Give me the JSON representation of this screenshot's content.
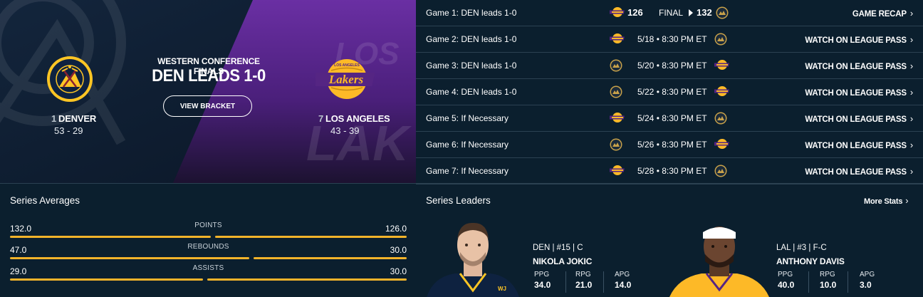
{
  "colors": {
    "background": "#0b1f2e",
    "accent_gold": "#f2b32a",
    "nuggets_navy": "#0e2240",
    "lakers_purple": "#552583",
    "divider": "#2b4152"
  },
  "hero": {
    "conference": "WESTERN CONFERENCE FINALS",
    "status": "DEN LEADS 1-0",
    "bracket_button": "VIEW BRACKET",
    "home_team": {
      "seed": "1",
      "name": "DENVER",
      "record": "53 - 29",
      "logo": "nuggets-logo"
    },
    "away_team": {
      "seed": "7",
      "name": "LOS ANGELES",
      "record": "43 - 39",
      "logo": "lakers-logo"
    }
  },
  "schedule": {
    "games": [
      {
        "label": "Game 1: DEN leads 1-0",
        "left_logo": "lakers-logo",
        "left_score": "126",
        "status": "FINAL",
        "right_score": "132",
        "right_logo": "nuggets-logo",
        "link": "GAME RECAP"
      },
      {
        "label": "Game 2: DEN leads 1-0",
        "left_logo": "lakers-logo",
        "date": "5/18 • 8:30 PM ET",
        "right_logo": "nuggets-logo",
        "link": "WATCH ON LEAGUE PASS"
      },
      {
        "label": "Game 3: DEN leads 1-0",
        "left_logo": "nuggets-logo",
        "date": "5/20 • 8:30 PM ET",
        "right_logo": "lakers-logo",
        "link": "WATCH ON LEAGUE PASS"
      },
      {
        "label": "Game 4: DEN leads 1-0",
        "left_logo": "nuggets-logo",
        "date": "5/22 • 8:30 PM ET",
        "right_logo": "lakers-logo",
        "link": "WATCH ON LEAGUE PASS"
      },
      {
        "label": "Game 5: If Necessary",
        "left_logo": "lakers-logo",
        "date": "5/24 • 8:30 PM ET",
        "right_logo": "nuggets-logo",
        "link": "WATCH ON LEAGUE PASS"
      },
      {
        "label": "Game 6: If Necessary",
        "left_logo": "nuggets-logo",
        "date": "5/26 • 8:30 PM ET",
        "right_logo": "lakers-logo",
        "link": "WATCH ON LEAGUE PASS"
      },
      {
        "label": "Game 7: If Necessary",
        "left_logo": "lakers-logo",
        "date": "5/28 • 8:30 PM ET",
        "right_logo": "nuggets-logo",
        "link": "WATCH ON LEAGUE PASS"
      }
    ],
    "chevron": "›"
  },
  "averages": {
    "title": "Series Averages",
    "rows": [
      {
        "stat": "POINTS",
        "left": "132.0",
        "right": "126.0",
        "left_value": 132.0,
        "right_value": 126.0
      },
      {
        "stat": "REBOUNDS",
        "left": "47.0",
        "right": "30.0",
        "left_value": 47.0,
        "right_value": 30.0
      },
      {
        "stat": "ASSISTS",
        "left": "29.0",
        "right": "30.0",
        "left_value": 29.0,
        "right_value": 30.0
      }
    ]
  },
  "leaders": {
    "title": "Series Leaders",
    "more_stats": "More Stats",
    "players": [
      {
        "meta": "DEN | #15 | C",
        "name": "NIKOLA JOKIC",
        "stats": [
          {
            "label": "PPG",
            "value": "34.0"
          },
          {
            "label": "RPG",
            "value": "21.0"
          },
          {
            "label": "APG",
            "value": "14.0"
          }
        ]
      },
      {
        "meta": "LAL | #3 | F-C",
        "name": "ANTHONY DAVIS",
        "stats": [
          {
            "label": "PPG",
            "value": "40.0"
          },
          {
            "label": "RPG",
            "value": "10.0"
          },
          {
            "label": "APG",
            "value": "3.0"
          }
        ]
      }
    ]
  }
}
